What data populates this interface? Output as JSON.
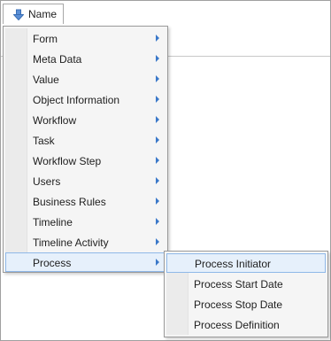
{
  "name_button": {
    "label": "Name",
    "icon": "sort-down-arrow-icon"
  },
  "menu": {
    "items": [
      {
        "label": "Form",
        "has_submenu": true
      },
      {
        "label": "Meta Data",
        "has_submenu": true
      },
      {
        "label": "Value",
        "has_submenu": true
      },
      {
        "label": "Object Information",
        "has_submenu": true
      },
      {
        "label": "Workflow",
        "has_submenu": true
      },
      {
        "label": "Task",
        "has_submenu": true
      },
      {
        "label": "Workflow Step",
        "has_submenu": true
      },
      {
        "label": "Users",
        "has_submenu": true
      },
      {
        "label": "Business Rules",
        "has_submenu": true
      },
      {
        "label": "Timeline",
        "has_submenu": true
      },
      {
        "label": "Timeline Activity",
        "has_submenu": true
      },
      {
        "label": "Process",
        "has_submenu": true,
        "highlighted": true
      }
    ]
  },
  "submenu": {
    "parent": "Process",
    "items": [
      {
        "label": "Process Initiator",
        "highlighted": true
      },
      {
        "label": "Process Start Date"
      },
      {
        "label": "Process Stop Date"
      },
      {
        "label": "Process Definition"
      }
    ]
  },
  "colors": {
    "accent": "#3a78c9",
    "highlight_bg": "#e6f0fb",
    "highlight_border": "#8fb8e8",
    "menu_bg": "#f5f5f5"
  }
}
